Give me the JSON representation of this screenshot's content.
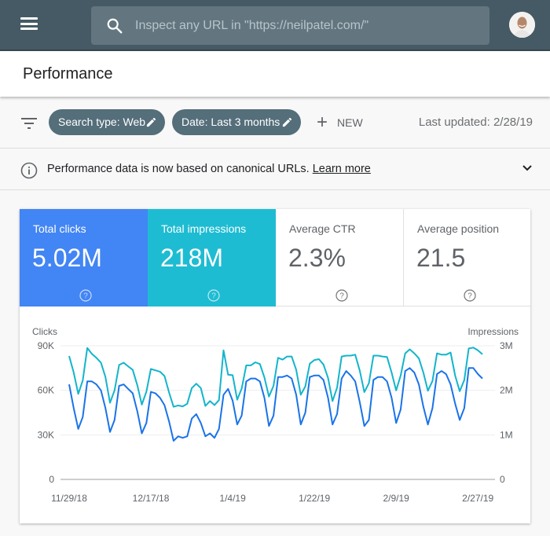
{
  "topbar": {
    "search_placeholder": "Inspect any URL in \"https://neilpatel.com/\"",
    "icons": {
      "menu": "hamburger-menu-icon",
      "search": "search-icon",
      "avatar": "user-avatar"
    }
  },
  "header": {
    "title": "Performance"
  },
  "filters": {
    "chips": [
      {
        "label": "Search type: Web",
        "icon": "pencil-icon"
      },
      {
        "label": "Date: Last 3 months",
        "icon": "pencil-icon"
      }
    ],
    "new_label": "NEW",
    "last_updated": "Last updated: 2/28/19"
  },
  "notice": {
    "text": "Performance data is now based on canonical URLs.",
    "link": "Learn more"
  },
  "metrics": [
    {
      "label": "Total clicks",
      "value": "5.02M",
      "color": "#4285f4",
      "selected": true
    },
    {
      "label": "Total impressions",
      "value": "218M",
      "color": "#1ebcd2",
      "selected": true
    },
    {
      "label": "Average CTR",
      "value": "2.3%",
      "selected": false
    },
    {
      "label": "Average position",
      "value": "21.5",
      "selected": false
    }
  ],
  "chart_data": {
    "type": "line",
    "left_axis": {
      "label": "Clicks",
      "ticks": [
        "0",
        "30K",
        "60K",
        "90K"
      ],
      "range": [
        0,
        90000
      ]
    },
    "right_axis": {
      "label": "Impressions",
      "ticks": [
        "0",
        "1M",
        "2M",
        "3M"
      ],
      "range": [
        0,
        3000000
      ]
    },
    "x_ticks": [
      "11/29/18",
      "12/17/18",
      "1/4/19",
      "1/22/19",
      "2/9/19",
      "2/27/19"
    ],
    "x_start": "11/29/18",
    "x_end": "2/28/19",
    "grid": true,
    "series": [
      {
        "name": "Clicks",
        "axis": "left",
        "color": "#1a73e8",
        "values": [
          64000,
          48000,
          34000,
          42000,
          66000,
          66000,
          64000,
          60000,
          48000,
          32000,
          40000,
          63000,
          64000,
          61000,
          58000,
          46000,
          31000,
          38000,
          59000,
          58000,
          55000,
          50000,
          39000,
          26000,
          29000,
          28000,
          29000,
          41000,
          44000,
          38000,
          29000,
          31000,
          28000,
          34000,
          57000,
          61000,
          53000,
          37000,
          43000,
          66000,
          68000,
          68000,
          66000,
          55000,
          36000,
          43000,
          69000,
          69000,
          70000,
          68000,
          57000,
          37000,
          45000,
          69000,
          70000,
          70000,
          67000,
          55000,
          37000,
          44000,
          68000,
          73000,
          70000,
          66000,
          52000,
          36000,
          40000,
          67000,
          69000,
          69000,
          66000,
          55000,
          38000,
          47000,
          73000,
          75000,
          72000,
          64000,
          49000,
          37000,
          48000,
          71000,
          73000,
          71000,
          64000,
          51000,
          40000,
          48000,
          75000,
          75000,
          71000,
          68000
        ]
      },
      {
        "name": "Impressions",
        "axis": "right",
        "color": "#12b5cb",
        "values": [
          2770000,
          2400000,
          1920000,
          2220000,
          2950000,
          2820000,
          2730000,
          2620000,
          2300000,
          1720000,
          2000000,
          2570000,
          2620000,
          2540000,
          2460000,
          2120000,
          1680000,
          1970000,
          2480000,
          2450000,
          2420000,
          2320000,
          1950000,
          1630000,
          1660000,
          1640000,
          1700000,
          2050000,
          2150000,
          2050000,
          1650000,
          1760000,
          1670000,
          1780000,
          2900000,
          2350000,
          2340000,
          1790000,
          2040000,
          2560000,
          2560000,
          2630000,
          2590000,
          2290000,
          1860000,
          2100000,
          2730000,
          2690000,
          2760000,
          2760000,
          2460000,
          1900000,
          2090000,
          2600000,
          2680000,
          2700000,
          2580000,
          2280000,
          1760000,
          2060000,
          2760000,
          2780000,
          2780000,
          2800000,
          2440000,
          1960000,
          2160000,
          2780000,
          2780000,
          2760000,
          2750000,
          2400000,
          2000000,
          2330000,
          2830000,
          2920000,
          2830000,
          2720000,
          2400000,
          1990000,
          2210000,
          2830000,
          2800000,
          2800000,
          2850000,
          2330000,
          1980000,
          2230000,
          2940000,
          2960000,
          2900000,
          2810000
        ]
      }
    ]
  }
}
